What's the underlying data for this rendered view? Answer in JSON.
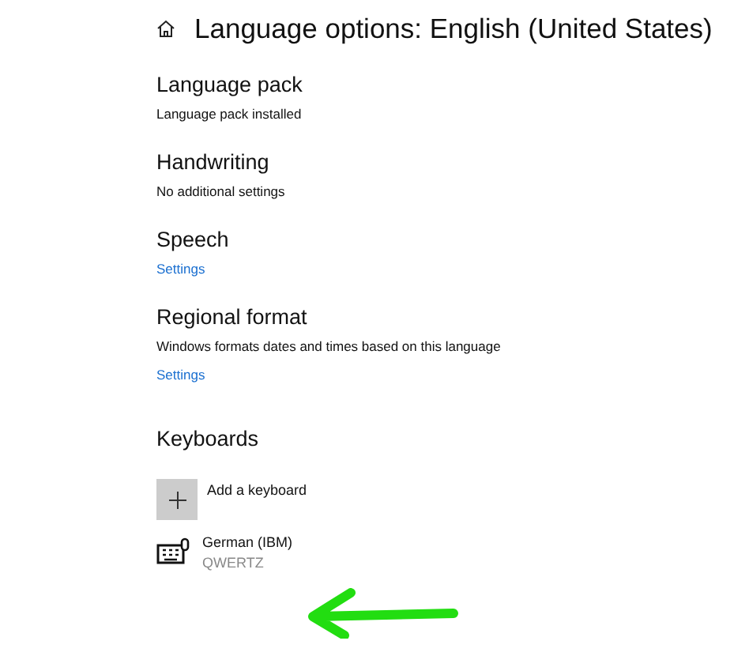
{
  "header": {
    "title": "Language options: English (United States)"
  },
  "sections": [
    {
      "heading": "Language pack",
      "lines": [
        {
          "kind": "text",
          "text": "Language pack installed"
        }
      ]
    },
    {
      "heading": "Handwriting",
      "lines": [
        {
          "kind": "text",
          "text": "No additional settings"
        }
      ]
    },
    {
      "heading": "Speech",
      "lines": [
        {
          "kind": "link",
          "text": "Settings"
        }
      ]
    },
    {
      "heading": "Regional format",
      "lines": [
        {
          "kind": "text",
          "text": "Windows formats dates and times based on this language"
        },
        {
          "kind": "link",
          "text": "Settings"
        }
      ]
    }
  ],
  "keyboards": {
    "heading": "Keyboards",
    "add_label": "Add a keyboard",
    "items": [
      {
        "name": "German (IBM)",
        "layout": "QWERTZ"
      }
    ]
  }
}
